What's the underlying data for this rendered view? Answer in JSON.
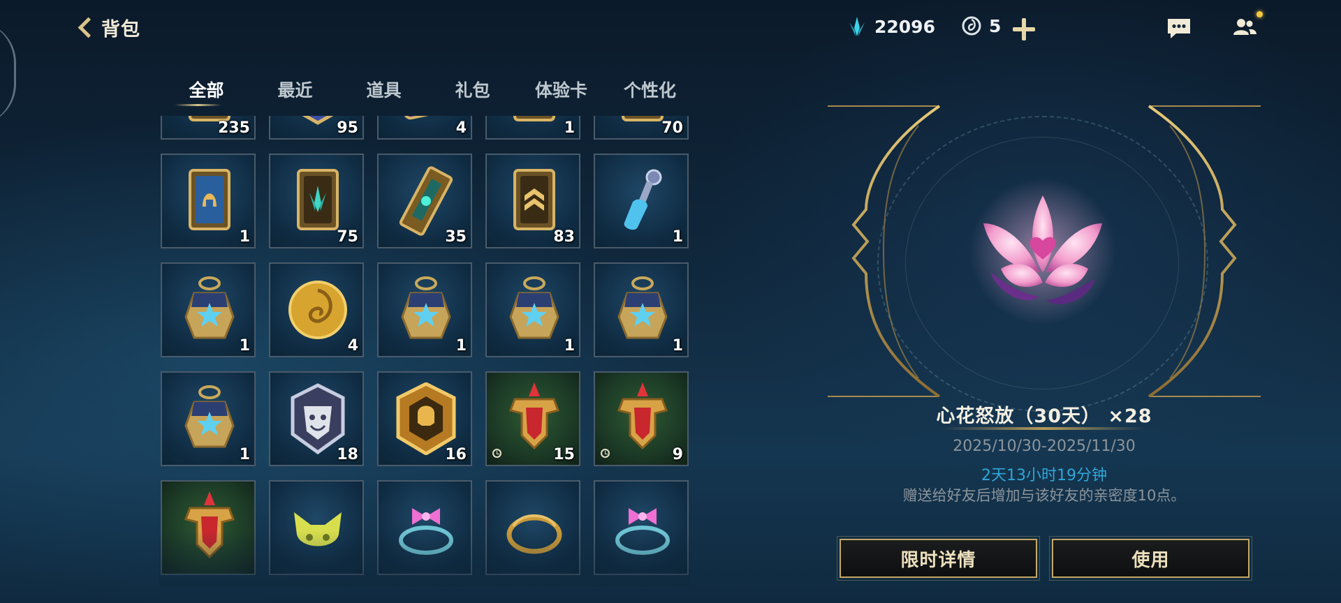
{
  "header": {
    "title": "背包",
    "currency_gems": "22096",
    "currency_tokens": "5"
  },
  "tabs": [
    {
      "label": "全部",
      "active": true
    },
    {
      "label": "最近",
      "active": false
    },
    {
      "label": "道具",
      "active": false
    },
    {
      "label": "礼包",
      "active": false
    },
    {
      "label": "体验卡",
      "active": false
    },
    {
      "label": "个性化",
      "active": false
    }
  ],
  "grid": {
    "items": [
      {
        "icon": "gold-card-helmet-icon",
        "count": "235"
      },
      {
        "icon": "hexagon-crystal-emblem-icon",
        "count": "95"
      },
      {
        "icon": "purple-orb-card-icon",
        "count": "4"
      },
      {
        "icon": "gold-card-diamond-icon",
        "count": "1"
      },
      {
        "icon": "gold-card-crystal-icon",
        "count": "70"
      },
      {
        "icon": "blue-card-helmet-icon",
        "count": "1"
      },
      {
        "icon": "gold-card-crystal-icon",
        "count": "75"
      },
      {
        "icon": "tilted-scroll-card-icon",
        "count": "35"
      },
      {
        "icon": "gold-card-chevron-icon",
        "count": "83"
      },
      {
        "icon": "blue-potion-bottle-icon",
        "count": "1"
      },
      {
        "icon": "star-treasure-pouch-icon",
        "count": "1"
      },
      {
        "icon": "gold-spiral-coin-icon",
        "count": "4"
      },
      {
        "icon": "star-treasure-pouch-icon",
        "count": "1"
      },
      {
        "icon": "star-treasure-pouch-icon",
        "count": "1"
      },
      {
        "icon": "star-treasure-pouch-icon",
        "count": "1"
      },
      {
        "icon": "star-treasure-pouch-icon",
        "count": "1"
      },
      {
        "icon": "silver-mask-emblem-icon",
        "count": "18"
      },
      {
        "icon": "gold-skull-shield-icon",
        "count": "16"
      },
      {
        "icon": "red-crest-banner-icon",
        "count": "15",
        "timed": true
      },
      {
        "icon": "red-crest-banner-icon",
        "count": "9",
        "timed": true
      },
      {
        "icon": "red-crest-banner-icon",
        "count": ""
      },
      {
        "icon": "yellow-creature-ears-icon",
        "count": ""
      },
      {
        "icon": "pink-bow-ring-icon",
        "count": ""
      },
      {
        "icon": "gold-dragon-ring-icon",
        "count": ""
      },
      {
        "icon": "pink-bow-ring-icon",
        "count": ""
      }
    ]
  },
  "detail": {
    "name": "心花怒放（30天） ×28",
    "date_range": "2025/10/30-2025/11/30",
    "remaining": "2天13小时19分钟",
    "description": "赠送给好友后增加与该好友的亲密度10点。",
    "icon": "pink-heart-flower-icon"
  },
  "buttons": {
    "detail_label": "限时详情",
    "use_label": "使用"
  },
  "colors": {
    "accent_gold": "#c6a964",
    "remaining_blue": "#2fa6d8",
    "gem_teal": "#38d6e8"
  }
}
